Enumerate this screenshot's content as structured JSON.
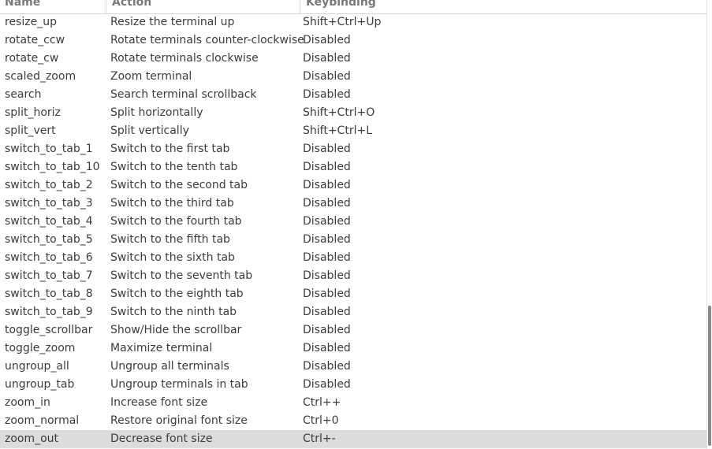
{
  "columns": {
    "name": "Name",
    "action": "Action",
    "keybinding": "Keybinding"
  },
  "rows": [
    {
      "name": "resize_up",
      "action": "Resize the terminal up",
      "key": "Shift+Ctrl+Up"
    },
    {
      "name": "rotate_ccw",
      "action": "Rotate terminals counter-clockwise",
      "key": "Disabled"
    },
    {
      "name": "rotate_cw",
      "action": "Rotate terminals clockwise",
      "key": "Disabled"
    },
    {
      "name": "scaled_zoom",
      "action": "Zoom terminal",
      "key": "Disabled"
    },
    {
      "name": "search",
      "action": "Search terminal scrollback",
      "key": "Disabled"
    },
    {
      "name": "split_horiz",
      "action": "Split horizontally",
      "key": "Shift+Ctrl+O"
    },
    {
      "name": "split_vert",
      "action": "Split vertically",
      "key": "Shift+Ctrl+L"
    },
    {
      "name": "switch_to_tab_1",
      "action": "Switch to the first tab",
      "key": "Disabled"
    },
    {
      "name": "switch_to_tab_10",
      "action": "Switch to the tenth tab",
      "key": "Disabled"
    },
    {
      "name": "switch_to_tab_2",
      "action": "Switch to the second tab",
      "key": "Disabled"
    },
    {
      "name": "switch_to_tab_3",
      "action": "Switch to the third tab",
      "key": "Disabled"
    },
    {
      "name": "switch_to_tab_4",
      "action": "Switch to the fourth tab",
      "key": "Disabled"
    },
    {
      "name": "switch_to_tab_5",
      "action": "Switch to the fifth tab",
      "key": "Disabled"
    },
    {
      "name": "switch_to_tab_6",
      "action": "Switch to the sixth tab",
      "key": "Disabled"
    },
    {
      "name": "switch_to_tab_7",
      "action": "Switch to the seventh tab",
      "key": "Disabled"
    },
    {
      "name": "switch_to_tab_8",
      "action": "Switch to the eighth tab",
      "key": "Disabled"
    },
    {
      "name": "switch_to_tab_9",
      "action": "Switch to the ninth tab",
      "key": "Disabled"
    },
    {
      "name": "toggle_scrollbar",
      "action": "Show/Hide the scrollbar",
      "key": "Disabled"
    },
    {
      "name": "toggle_zoom",
      "action": "Maximize terminal",
      "key": "Disabled"
    },
    {
      "name": "ungroup_all",
      "action": "Ungroup all terminals",
      "key": "Disabled"
    },
    {
      "name": "ungroup_tab",
      "action": "Ungroup terminals in tab",
      "key": "Disabled"
    },
    {
      "name": "zoom_in",
      "action": "Increase font size",
      "key": "Ctrl++"
    },
    {
      "name": "zoom_normal",
      "action": "Restore original font size",
      "key": "Ctrl+0"
    },
    {
      "name": "zoom_out",
      "action": "Decrease font size",
      "key": "Ctrl+-"
    }
  ],
  "selected_row": 23,
  "colors": {
    "selected_background": "#dcdcdc",
    "text": "#3c3c3c",
    "header_text": "#7a7a7a",
    "scroll_thumb": "#8a8a8a"
  }
}
